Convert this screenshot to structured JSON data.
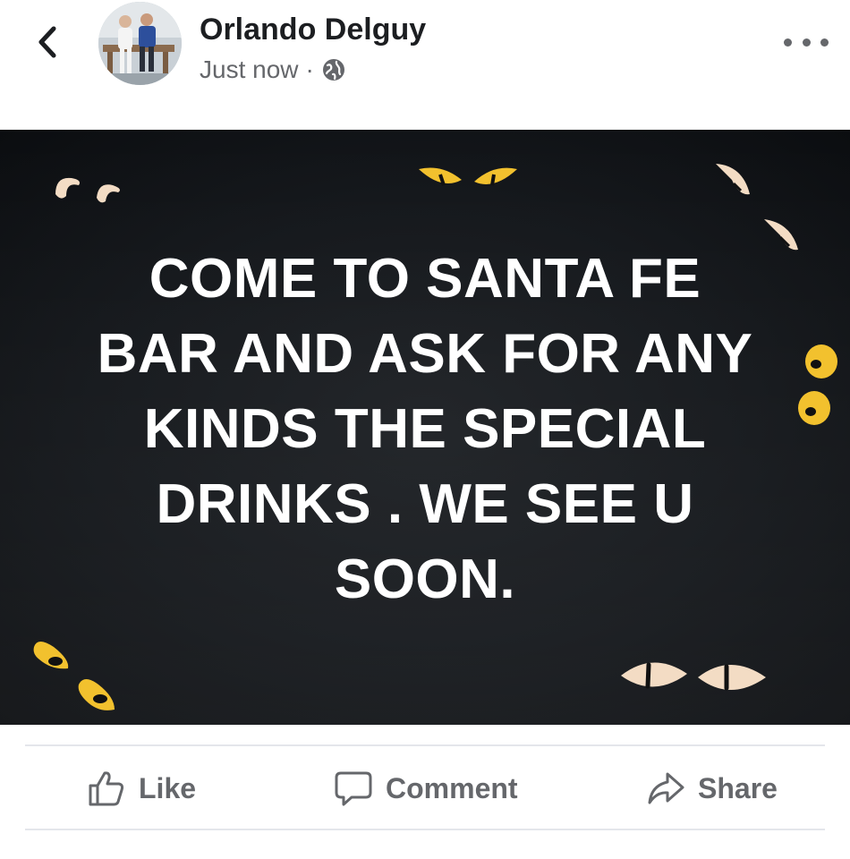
{
  "post": {
    "author": "Orlando Delguy",
    "timestamp": "Just now",
    "meta_separator": "·",
    "privacy_icon": "globe-icon",
    "image_text": "COME TO SANTA FE\nBAR AND ASK FOR ANY\nKINDS THE SPECIAL\nDRINKS . WE SEE U\nSOON."
  },
  "actions": {
    "like": "Like",
    "comment": "Comment",
    "share": "Share"
  },
  "icons": {
    "back": "chevron-left-icon",
    "more": "more-horizontal-icon",
    "like": "thumbs-up-icon",
    "comment": "speech-bubble-icon",
    "share": "share-arrow-icon"
  },
  "colors": {
    "text_primary": "#1c1e21",
    "text_secondary": "#65676b",
    "image_background": "#14171b",
    "eyes_cream": "#f3dcc4",
    "eyes_yellow": "#f2c12e"
  }
}
